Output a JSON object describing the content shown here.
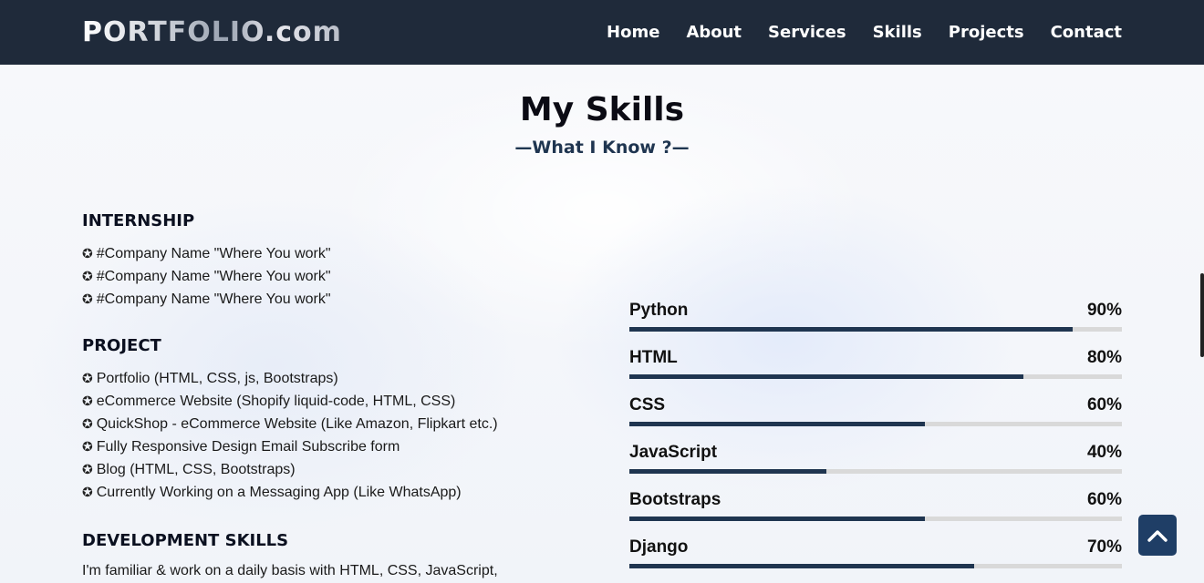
{
  "header": {
    "logo": "PORTFOLIO.com",
    "nav": [
      "Home",
      "About",
      "Services",
      "Skills",
      "Projects",
      "Contact"
    ]
  },
  "section": {
    "title": "My Skills",
    "subtitle": "—What I Know ?—"
  },
  "internship": {
    "heading": "INTERNSHIP",
    "items": [
      "#Company Name \"Where You work\"",
      "#Company Name \"Where You work\"",
      "#Company Name \"Where You work\""
    ]
  },
  "project": {
    "heading": "PROJECT",
    "items": [
      "Portfolio (HTML, CSS, js, Bootstraps)",
      "eCommerce Website (Shopify liquid-code, HTML, CSS)",
      "QuickShop - eCommerce Website (Like Amazon, Flipkart etc.)",
      "Fully Responsive Design Email Subscribe form",
      "Blog (HTML, CSS, Bootstraps)",
      "Currently Working on a Messaging App (Like WhatsApp)"
    ]
  },
  "development": {
    "heading": "DEVELOPMENT SKILLS",
    "text": "I'm familiar & work on a daily basis with HTML, CSS, JavaScript,"
  },
  "bullet_glyph": "✪",
  "skills": [
    {
      "name": "Python",
      "percent_label": "90%",
      "level": 0.9
    },
    {
      "name": "HTML",
      "percent_label": "80%",
      "level": 0.8
    },
    {
      "name": "CSS",
      "percent_label": "60%",
      "level": 0.6
    },
    {
      "name": "JavaScript",
      "percent_label": "40%",
      "level": 0.4
    },
    {
      "name": "Bootstraps",
      "percent_label": "60%",
      "level": 0.6
    },
    {
      "name": "Django",
      "percent_label": "70%",
      "level": 0.7
    }
  ],
  "colors": {
    "navbar": "#1f2a3a",
    "accent": "#1f3550",
    "track": "#d9d9d9",
    "scroll_button": "#1f3e66"
  },
  "icons": {
    "scroll_top": "chevron-up-icon",
    "bullet": "star-circle-icon"
  }
}
